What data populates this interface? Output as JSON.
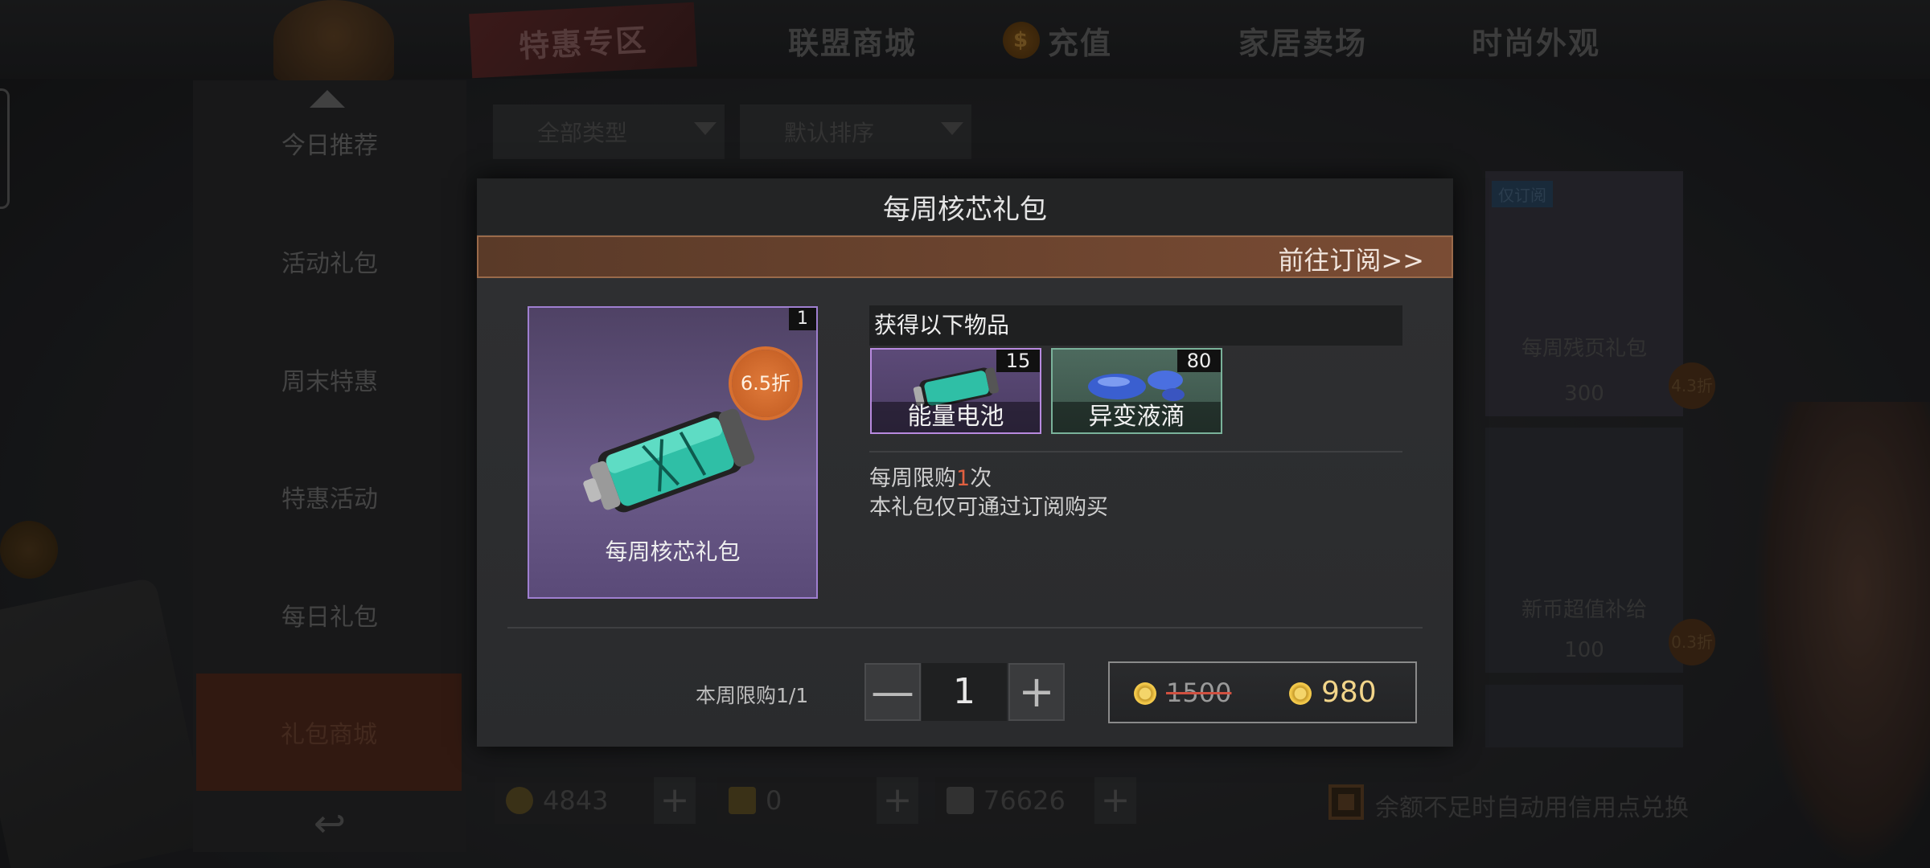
{
  "topbar": {
    "tabs": [
      {
        "label": "特惠专区"
      },
      {
        "label": "联盟商城"
      },
      {
        "label": "充值"
      },
      {
        "label": "家居卖场"
      },
      {
        "label": "时尚外观"
      }
    ]
  },
  "sidebar": {
    "items": [
      {
        "label": "今日推荐"
      },
      {
        "label": "活动礼包"
      },
      {
        "label": "周末特惠"
      },
      {
        "label": "特惠活动"
      },
      {
        "label": "每日礼包"
      },
      {
        "label": "礼包商城"
      }
    ]
  },
  "filters": {
    "type_label": "全部类型",
    "sort_label": "默认排序"
  },
  "bg_cards": [
    {
      "tag": "仅订阅",
      "name": "每周残页礼包",
      "price": "300",
      "discount": "4.3折"
    },
    {
      "name": "新币超值补给",
      "price": "100",
      "discount": "0.3折"
    }
  ],
  "currencies": [
    {
      "value": "4843",
      "icon": "gear-coin-icon"
    },
    {
      "value": "0",
      "icon": "ticket-icon"
    },
    {
      "value": "76626",
      "icon": "gold-bar-icon"
    }
  ],
  "auto_credit": {
    "label": "余额不足时自动用信用点兑换"
  },
  "modal": {
    "title": "每周核芯礼包",
    "subscribe_link": "前往订阅>>",
    "pack": {
      "name": "每周核芯礼包",
      "count": "1",
      "discount": "6.5折"
    },
    "obtain_header": "获得以下物品",
    "items": [
      {
        "name": "能量电池",
        "count": "15"
      },
      {
        "name": "异变液滴",
        "count": "80"
      }
    ],
    "limit_prefix": "每周限购",
    "limit_number": "1",
    "limit_suffix": "次",
    "subscribe_only": "本礼包仅可通过订阅购买",
    "week_limit": "本周限购1/1",
    "quantity": "1",
    "minus": "—",
    "plus": "+",
    "original_price": "1500",
    "price": "980"
  },
  "colors": {
    "accent_orange": "#c05a20",
    "price_gold": "#f2d58a",
    "pack_purple": "#6a5a88"
  }
}
